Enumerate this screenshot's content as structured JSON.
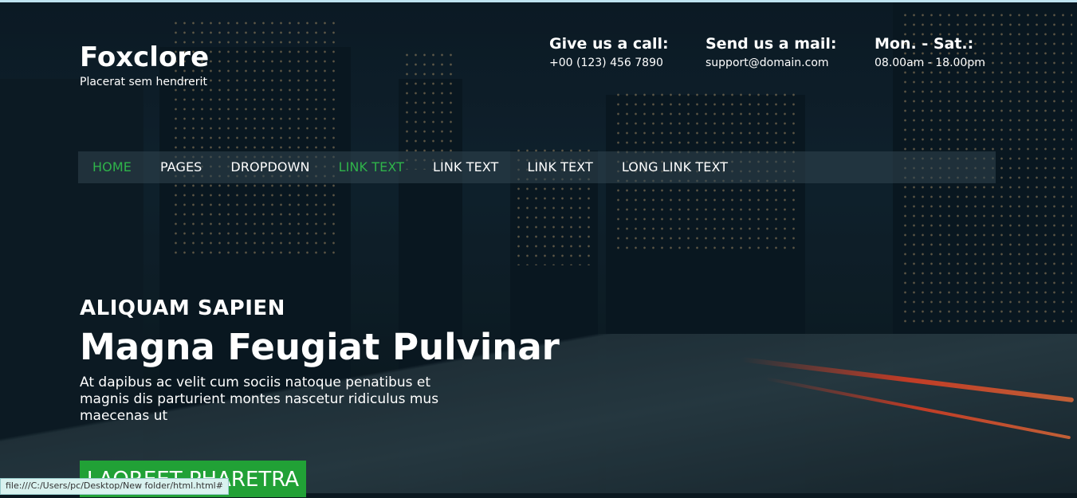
{
  "brand": {
    "name": "Foxclore",
    "tagline": "Placerat sem hendrerit"
  },
  "contacts": [
    {
      "heading": "Give us a call:",
      "value": "+00 (123) 456 7890"
    },
    {
      "heading": "Send us a mail:",
      "value": "support@domain.com"
    },
    {
      "heading": "Mon. - Sat.:",
      "value": "08.00am - 18.00pm"
    }
  ],
  "nav": {
    "items": [
      {
        "label": "HOME",
        "active": true
      },
      {
        "label": "PAGES",
        "active": false
      },
      {
        "label": "DROPDOWN",
        "active": false
      },
      {
        "label": "LINK TEXT",
        "active": true
      },
      {
        "label": "LINK TEXT",
        "active": false
      },
      {
        "label": "LINK TEXT",
        "active": false
      },
      {
        "label": "LONG LINK TEXT",
        "active": false
      }
    ]
  },
  "hero": {
    "subtitle": "ALIQUAM SAPIEN",
    "title": "Magna Feugiat Pulvinar",
    "text": "At dapibus ac velit cum sociis natoque penatibus et magnis dis parturient montes nascetur ridiculus mus maecenas ut",
    "button_label": "LAOREET PHARETRA"
  },
  "status_bar": {
    "url": "file:///C:/Users/pc/Desktop/New folder/html.html#"
  },
  "colors": {
    "accent": "#21a136",
    "active_link": "#2fb34a",
    "top_border": "#bfe3f0"
  }
}
